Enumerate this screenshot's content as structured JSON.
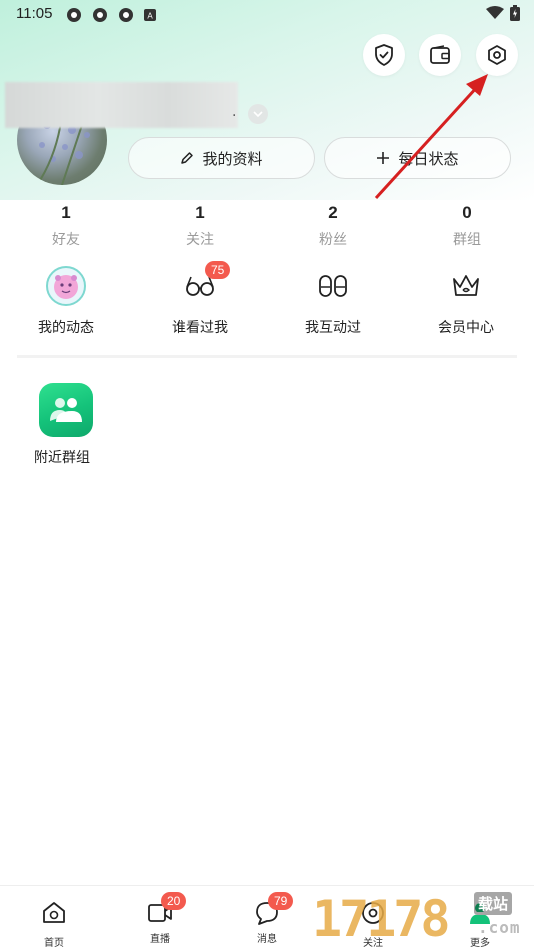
{
  "status_bar": {
    "time": "11:05"
  },
  "header": {
    "icons": [
      "shield-check-icon",
      "wallet-icon",
      "settings-hexagon-icon"
    ]
  },
  "profile": {
    "edit_profile_label": "我的资料",
    "daily_status_label": "每日状态"
  },
  "stats": [
    {
      "value": "1",
      "label": "好友"
    },
    {
      "value": "1",
      "label": "关注"
    },
    {
      "value": "2",
      "label": "粉丝"
    },
    {
      "value": "0",
      "label": "群组"
    }
  ],
  "quick_actions": [
    {
      "label": "我的动态",
      "icon": "avatar-sticker-icon"
    },
    {
      "label": "谁看过我",
      "icon": "glasses-icon",
      "badge": "75"
    },
    {
      "label": "我互动过",
      "icon": "footprints-icon"
    },
    {
      "label": "会员中心",
      "icon": "crown-icon"
    }
  ],
  "apps": [
    {
      "label": "附近群组",
      "icon": "nearby-group-icon"
    }
  ],
  "bottom_nav": [
    {
      "label": "首页",
      "icon": "home-icon"
    },
    {
      "label": "直播",
      "icon": "live-video-icon",
      "badge": "20"
    },
    {
      "label": "消息",
      "icon": "message-icon",
      "badge": "79"
    },
    {
      "label": "关注",
      "icon": "follow-eye-icon"
    },
    {
      "label": "更多",
      "icon": "profile-more-icon"
    }
  ],
  "watermark": {
    "digits": "17178",
    "site": "载站",
    "domain": ".com"
  },
  "colors": {
    "accent_green": "#14c27a",
    "badge_red": "#f35a4e",
    "annotation_red": "#d62020"
  }
}
